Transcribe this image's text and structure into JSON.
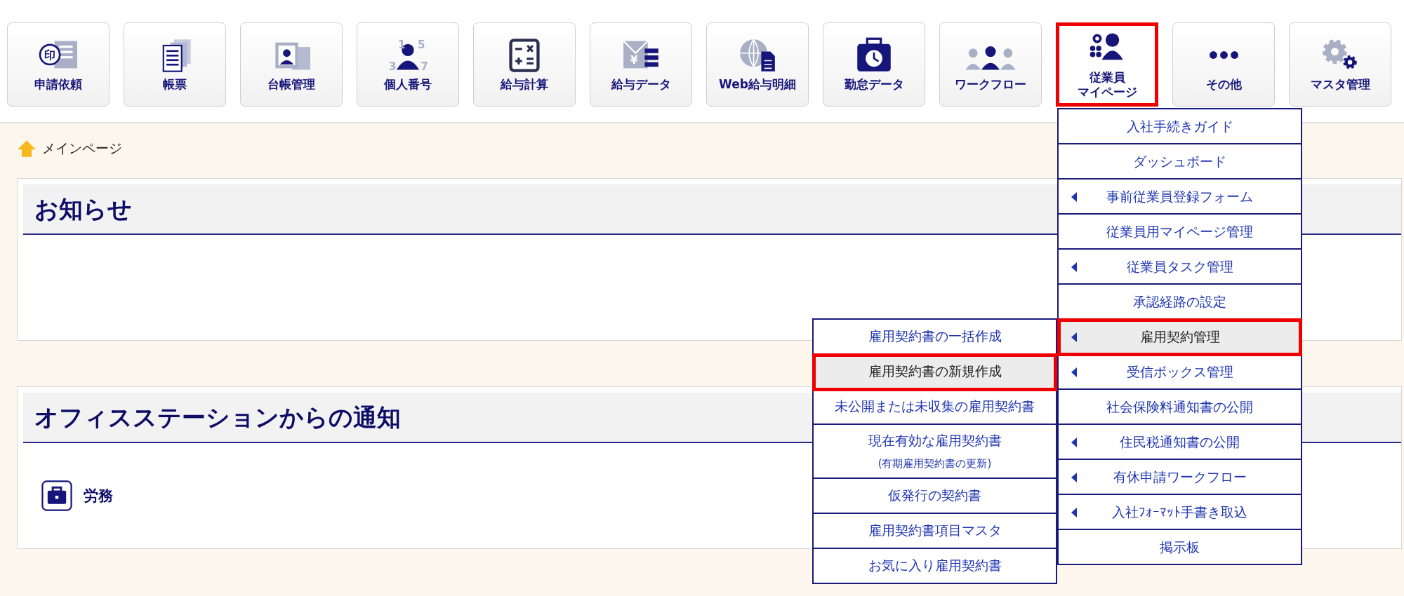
{
  "toolbar": [
    {
      "label": "申請依頼",
      "selected": false,
      "icon_text": [
        "印"
      ]
    },
    {
      "label": "帳票",
      "selected": false
    },
    {
      "label": "台帳管理",
      "selected": false
    },
    {
      "label": "個人番号",
      "selected": false,
      "icon_text": [
        "1",
        "5",
        "3",
        "7"
      ]
    },
    {
      "label": "給与計算",
      "selected": false
    },
    {
      "label": "給与データ",
      "selected": false,
      "icon_text": [
        "¥"
      ]
    },
    {
      "label": "Web給与明細",
      "selected": false
    },
    {
      "label": "勤怠データ",
      "selected": false
    },
    {
      "label": "ワークフロー",
      "selected": false
    },
    {
      "label_lines": [
        "従業員",
        "マイページ"
      ],
      "selected": true
    },
    {
      "label": "その他",
      "selected": false
    },
    {
      "label": "マスタ管理",
      "selected": false
    }
  ],
  "breadcrumb": "メインページ",
  "panels": [
    {
      "title": "お知らせ"
    },
    {
      "title": "オフィスステーションからの通知",
      "items": [
        "労務"
      ]
    }
  ],
  "menu": [
    {
      "label": "入社手続きガイド",
      "submenu": false,
      "selected": false
    },
    {
      "label": "ダッシュボード",
      "submenu": false,
      "selected": false
    },
    {
      "label": "事前従業員登録フォーム",
      "submenu": true,
      "selected": false
    },
    {
      "label": "従業員用マイページ管理",
      "submenu": false,
      "selected": false
    },
    {
      "label": "従業員タスク管理",
      "submenu": true,
      "selected": false
    },
    {
      "label": "承認経路の設定",
      "submenu": false,
      "selected": false
    },
    {
      "label": "雇用契約管理",
      "submenu": true,
      "selected": true,
      "children": [
        {
          "label": "雇用契約書の一括作成",
          "selected": false
        },
        {
          "label": "雇用契約書の新規作成",
          "selected": true
        },
        {
          "label": "未公開または未収集の雇用契約書",
          "selected": false
        },
        {
          "label": "現在有効な雇用契約書",
          "note": "(有期雇用契約書の更新)",
          "selected": false
        },
        {
          "label": "仮発行の契約書",
          "selected": false
        },
        {
          "label": "雇用契約書項目マスタ",
          "selected": false
        },
        {
          "label": "お気に入り雇用契約書",
          "selected": false
        }
      ]
    },
    {
      "label": "受信ボックス管理",
      "submenu": true,
      "selected": false
    },
    {
      "label": "社会保険料通知書の公開",
      "submenu": false,
      "selected": false
    },
    {
      "label": "住民税通知書の公開",
      "submenu": true,
      "selected": false
    },
    {
      "label": "有休申請ワークフロー",
      "submenu": true,
      "selected": false
    },
    {
      "label": "入社ﾌｫｰﾏｯﾄ手書き取込",
      "submenu": true,
      "selected": false
    },
    {
      "label": "掲示板",
      "submenu": false,
      "selected": false
    }
  ]
}
